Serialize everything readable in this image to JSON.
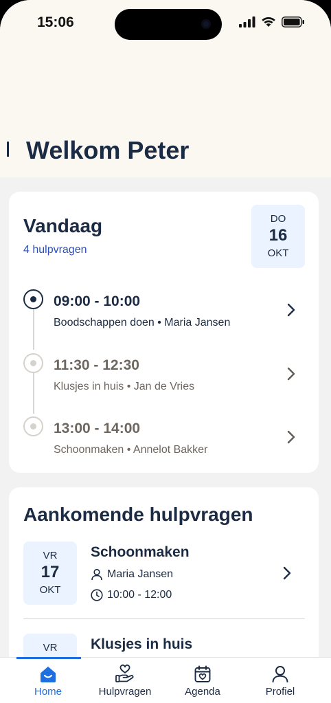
{
  "status_bar": {
    "time": "15:06"
  },
  "header": {
    "greeting": "Welkom Peter"
  },
  "today": {
    "title": "Vandaag",
    "count_label": "4 hulpvragen",
    "date": {
      "day": "DO",
      "number": "16",
      "month": "OKT"
    },
    "appointments": [
      {
        "time": "09:00 - 10:00",
        "description": "Boodschappen doen • Maria Jansen",
        "active": true
      },
      {
        "time": "11:30 - 12:30",
        "description": "Klusjes in huis • Jan de Vries",
        "active": false
      },
      {
        "time": "13:00 - 14:00",
        "description": "Schoonmaken • Annelot Bakker",
        "active": false
      }
    ]
  },
  "upcoming": {
    "title": "Aankomende hulpvragen",
    "items": [
      {
        "day": "VR",
        "number": "17",
        "month": "OKT",
        "title": "Schoonmaken",
        "person": "Maria Jansen",
        "time": "10:00 - 12:00"
      },
      {
        "day": "VR",
        "title": "Klusjes in huis"
      }
    ]
  },
  "tabbar": {
    "tabs": [
      {
        "label": "Home",
        "icon": "home-icon",
        "selected": true
      },
      {
        "label": "Hulpvragen",
        "icon": "helping-hand-heart-icon",
        "selected": false
      },
      {
        "label": "Agenda",
        "icon": "calendar-heart-icon",
        "selected": false
      },
      {
        "label": "Profiel",
        "icon": "person-icon",
        "selected": false
      }
    ]
  },
  "colors": {
    "primary": "#1c2b44",
    "accent": "#1e6fe0",
    "header_bg": "#faf8f1",
    "date_bg": "#eaf3ff"
  }
}
